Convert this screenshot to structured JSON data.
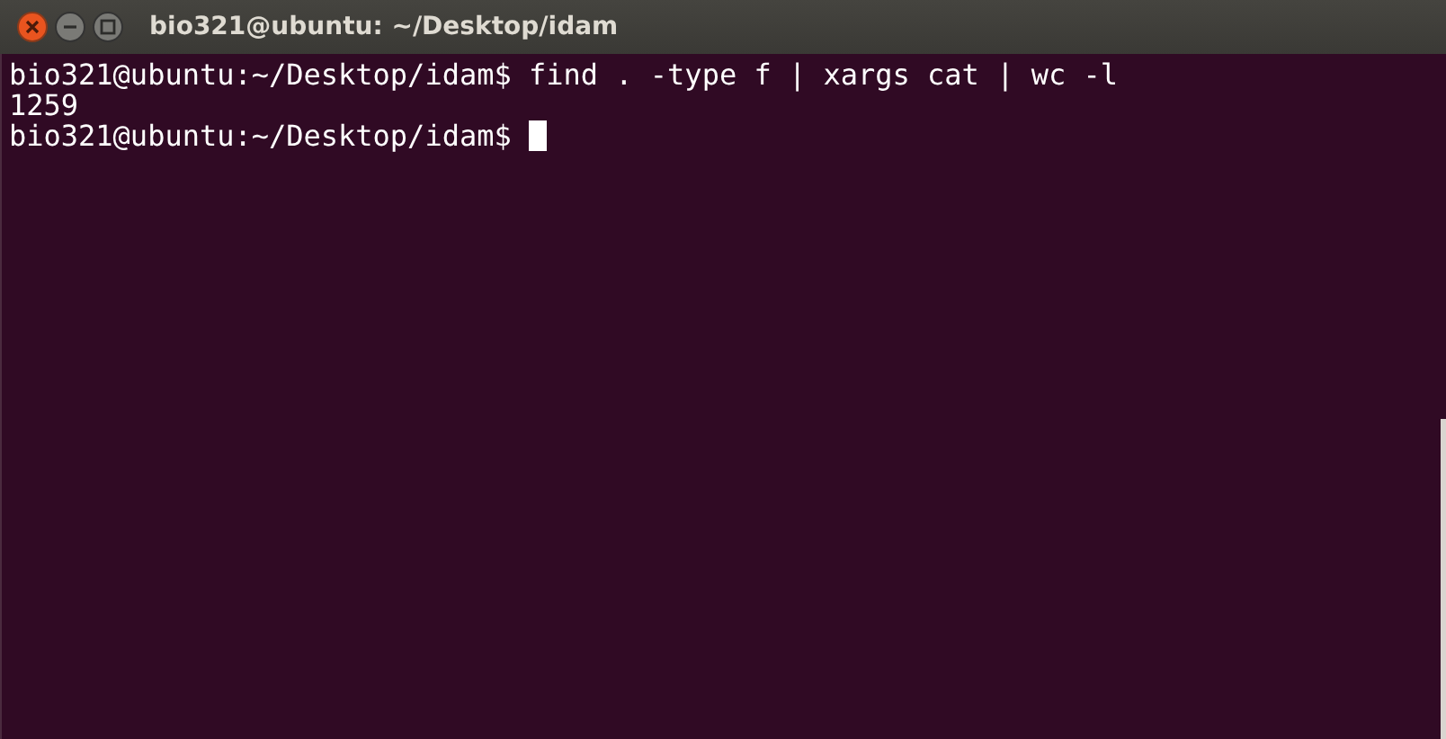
{
  "window": {
    "title": "bio321@ubuntu: ~/Desktop/idam"
  },
  "terminal": {
    "lines": [
      {
        "text": "bio321@ubuntu:~/Desktop/idam$ find . -type f | xargs cat | wc -l",
        "cursor": false
      },
      {
        "text": "1259",
        "cursor": false
      },
      {
        "text": "bio321@ubuntu:~/Desktop/idam$ ",
        "cursor": true
      }
    ]
  }
}
